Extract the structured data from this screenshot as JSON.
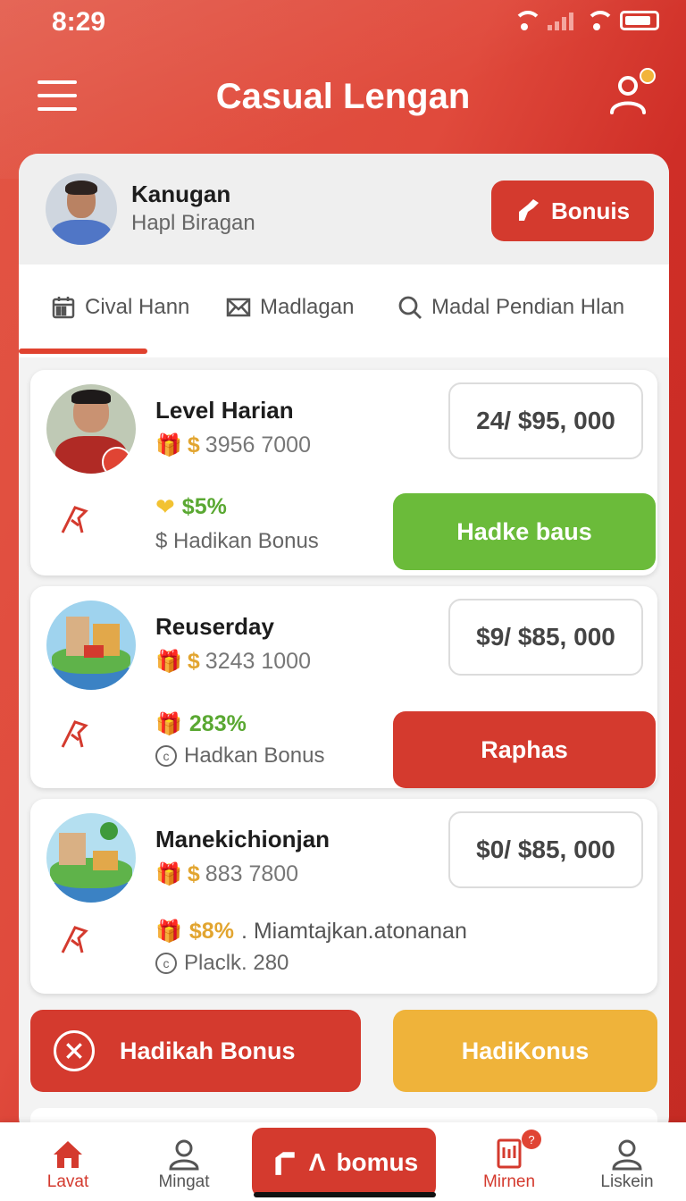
{
  "status": {
    "time": "8:29"
  },
  "header": {
    "title": "Casual Lengan"
  },
  "user": {
    "name": "Kanugan",
    "subtitle": "Hapl Biragan",
    "bonus_label": "Bonuis"
  },
  "tabs": [
    {
      "label": "Cival Hann",
      "icon": "calendar-icon"
    },
    {
      "label": "Madlagan",
      "icon": "mail-icon"
    },
    {
      "label": "Madal Pendian Hlan",
      "icon": "search-icon"
    }
  ],
  "cards": [
    {
      "title": "Level Harian",
      "amount_symbol": "$",
      "amount": "3956 7000",
      "price": "24/ $95, 000",
      "percent": "$5%",
      "percent_color": "#5aa832",
      "sub_text": "$ Hadikаn Bonus",
      "action_label": "Hadke baus",
      "action_color": "#6bbb3a"
    },
    {
      "title": "Reuserday",
      "amount_symbol": "$",
      "amount": "3243 1000",
      "price": "$9/ $85, 000",
      "percent": "283%",
      "percent_color": "#5aa832",
      "sub_text": "Hadkan Bonus",
      "action_label": "Raphas",
      "action_color": "#d43a2e"
    },
    {
      "title": "Manekichionjan",
      "amount_symbol": "$",
      "amount": "883 7800",
      "price": "$0/ $85, 000",
      "percent": "$8%",
      "percent_color": "#e2a530",
      "percent_note": ". Miamtajkan.atonanan",
      "sub_text": "Placlk. 280"
    }
  ],
  "bottom_buttons": {
    "left_label": "Hadikah Bonus",
    "right_label": "HadiKonus"
  },
  "nav": {
    "items": [
      {
        "label": "Lavat"
      },
      {
        "label": "Mingat"
      },
      {
        "label": "Mirnen"
      },
      {
        "label": "Liskein"
      }
    ],
    "center_label": "bomus",
    "center_prefix": "Λ"
  },
  "colors": {
    "brand_red": "#d43a2e",
    "green": "#6bbb3a",
    "yellow": "#efb33a"
  }
}
